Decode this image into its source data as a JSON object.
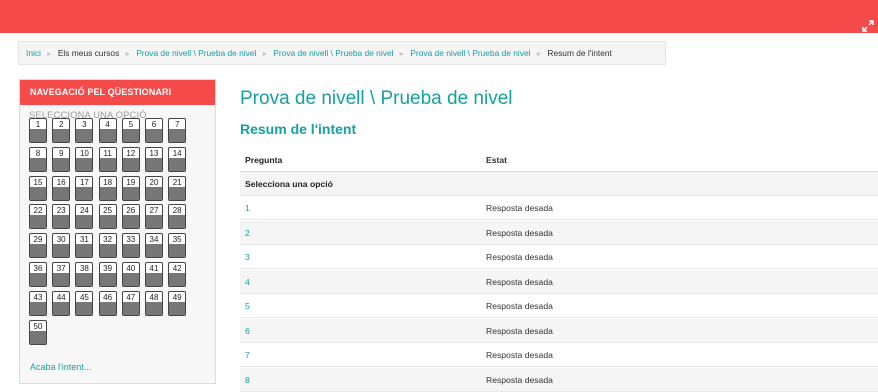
{
  "topbar": {
    "expand_icon": "expand-icon",
    "color": "#f54a4a"
  },
  "breadcrumb": {
    "items": [
      {
        "label": "Inici",
        "type": "link"
      },
      {
        "label": "Els meus cursos",
        "type": "plain"
      },
      {
        "label": "Prova de nivell \\ Prueba de nivel",
        "type": "link"
      },
      {
        "label": "Prova de nivell \\ Prueba de nivel",
        "type": "link"
      },
      {
        "label": "Prova de nivell \\ Prueba de nivel",
        "type": "link"
      },
      {
        "label": "Resum de l'intent",
        "type": "current"
      }
    ],
    "separator": "►"
  },
  "quiznav": {
    "title": "NAVEGACIÓ PEL QÜESTIONARI",
    "section": "SELECCIONA UNA OPCIÓ",
    "questions": [
      "1",
      "2",
      "3",
      "4",
      "5",
      "6",
      "7",
      "8",
      "9",
      "10",
      "11",
      "12",
      "13",
      "14",
      "15",
      "16",
      "17",
      "18",
      "19",
      "20",
      "21",
      "22",
      "23",
      "24",
      "25",
      "26",
      "27",
      "28",
      "29",
      "30",
      "31",
      "32",
      "33",
      "34",
      "35",
      "36",
      "37",
      "38",
      "39",
      "40",
      "41",
      "42",
      "43",
      "44",
      "45",
      "46",
      "47",
      "48",
      "49",
      "50"
    ],
    "finish_link": "Acaba l'intent..."
  },
  "main": {
    "title": "Prova de nivell \\ Prueba de nivel",
    "subtitle": "Resum de l'intent",
    "table": {
      "headers": [
        "Pregunta",
        "Estat"
      ],
      "group": "Selecciona una opció",
      "rows": [
        {
          "question": "1",
          "status": "Resposta desada"
        },
        {
          "question": "2",
          "status": "Resposta desada"
        },
        {
          "question": "3",
          "status": "Resposta desada"
        },
        {
          "question": "4",
          "status": "Resposta desada"
        },
        {
          "question": "5",
          "status": "Resposta desada"
        },
        {
          "question": "6",
          "status": "Resposta desada"
        },
        {
          "question": "7",
          "status": "Resposta desada"
        },
        {
          "question": "8",
          "status": "Resposta desada"
        }
      ]
    }
  },
  "colors": {
    "accent": "#f54a4a",
    "link": "#16a0a0"
  }
}
